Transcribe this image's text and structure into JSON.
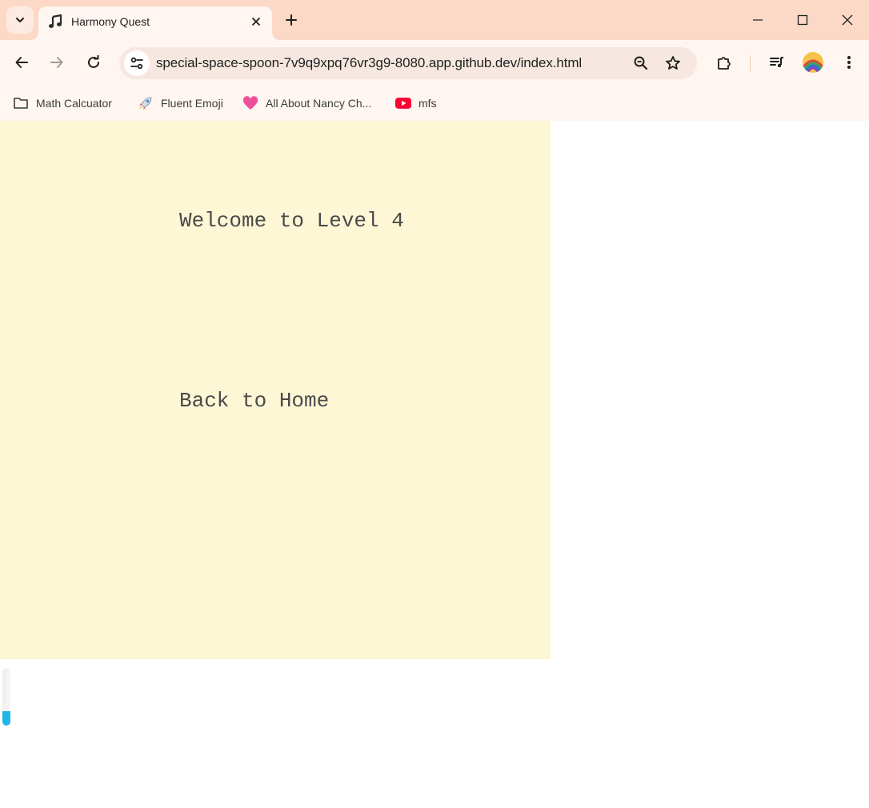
{
  "browser": {
    "tab": {
      "title": "Harmony Quest",
      "favicon": "music-note-icon"
    },
    "address_bar": {
      "url": "special-space-spoon-7v9q9xpq76vr3g9-8080.app.github.dev/index.html"
    },
    "bookmarks": [
      {
        "label": "Math Calcuator",
        "icon": "folder-icon"
      },
      {
        "label": "Fluent Emoji",
        "icon": "rocket-icon"
      },
      {
        "label": "All About Nancy Ch...",
        "icon": "heart-icon"
      },
      {
        "label": "mfs",
        "icon": "youtube-icon"
      }
    ],
    "colors": {
      "tabstrip": "#fcd9c6",
      "toolbar": "#fff6f1",
      "omnibox": "#f6e8e0"
    }
  },
  "page": {
    "welcome_text": "Welcome to Level 4",
    "back_link": "Back to Home",
    "panel_color": "#fdf7d6",
    "text_color": "#4a4a4a",
    "scroll_indicator": {
      "fill_fraction": 0.25,
      "color": "#1fb6e8"
    }
  }
}
